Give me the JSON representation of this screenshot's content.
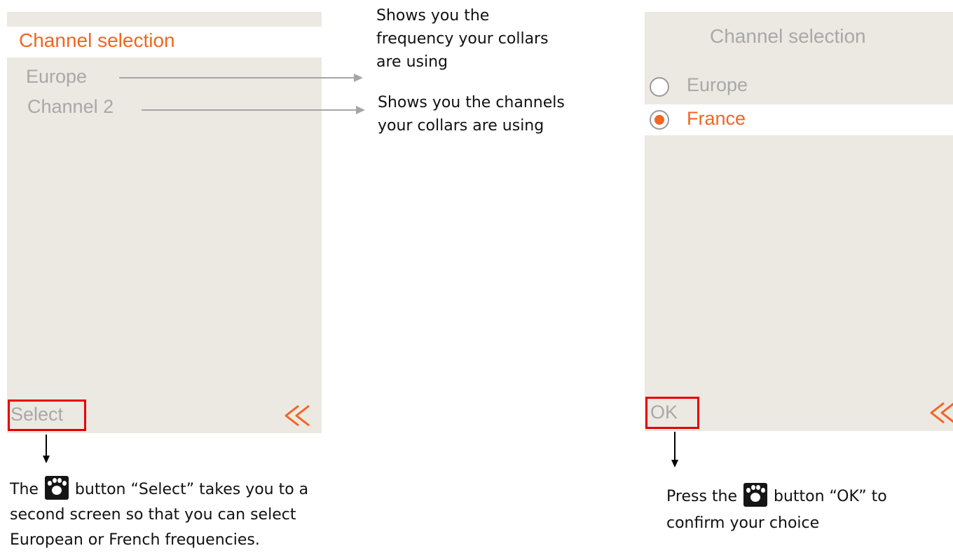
{
  "left_screen": {
    "title": "Channel selection",
    "frequency_value": "Europe",
    "channel_value": "Channel 2",
    "softkey_left": "Select",
    "back_icon": "double-chevron-left-icon"
  },
  "right_screen": {
    "title": "Channel selection",
    "options": [
      {
        "label": "Europe",
        "selected": false
      },
      {
        "label": "France",
        "selected": true
      }
    ],
    "softkey_left": "OK",
    "back_icon": "double-chevron-left-icon"
  },
  "annotations": {
    "frequency_note": [
      "Shows you the",
      "frequency your collars",
      "are using"
    ],
    "channel_note": [
      "Shows you the channels",
      "your collars are using"
    ],
    "select_note": {
      "before_icon": "The",
      "after_icon": "button “Select” takes you to a",
      "line2": "second screen so that you can select",
      "line3": "European or French frequencies."
    },
    "ok_note": {
      "before_icon": "Press the",
      "after_icon": "button “OK” to",
      "line2": "confirm your choice"
    },
    "paw_icon": "paw-icon"
  },
  "colors": {
    "accent": "#f26522",
    "screen_bg": "#ece9e2",
    "muted_text": "#a8a8a8",
    "highlight_box": "#e60000"
  }
}
